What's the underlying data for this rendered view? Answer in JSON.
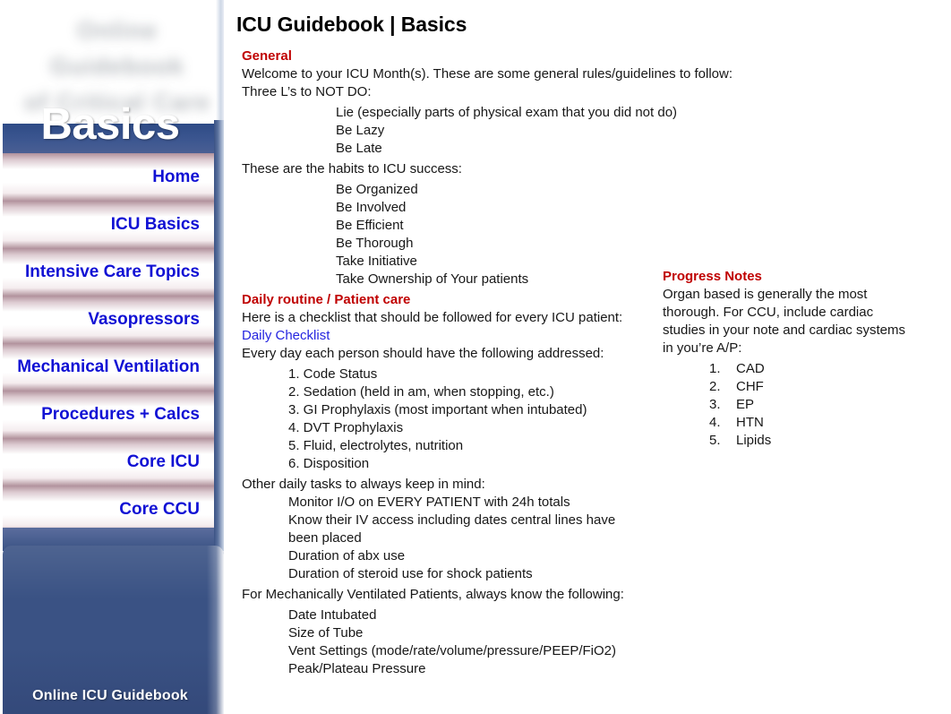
{
  "page_title": "ICU Guidebook | Basics",
  "sidebar": {
    "logo_placeholder": "Online Guidebook\nof Critical Care",
    "nav_items": [
      {
        "label": "Home"
      },
      {
        "label": "ICU Basics"
      },
      {
        "label": "Intensive Care Topics"
      },
      {
        "label": "Vasopressors"
      },
      {
        "label": "Mechanical Ventilation"
      },
      {
        "label": "Procedures + Calcs"
      },
      {
        "label": "Core ICU"
      },
      {
        "label": "Core CCU"
      }
    ],
    "brand_title": "Basics",
    "brand_subtitle": "Online ICU Guidebook"
  },
  "colors": {
    "section_heading": "#c00000",
    "nav_text": "#1111d4",
    "link": "#2424e0",
    "panel_blue": "#3a5284",
    "stripe": "#804d5e",
    "body_text": "#171717"
  },
  "content": {
    "general": {
      "heading": "General",
      "intro": "Welcome to your ICU Month(s). These are some general rules/guidelines to follow:",
      "not_do_label": "Three L’s to NOT DO:",
      "not_do_items": [
        "Lie (especially parts of physical exam that you did not do)",
        "Be Lazy",
        "Be Late"
      ],
      "habits_label": "These are the habits to ICU success:",
      "habits_items": [
        "Be Organized",
        "Be Involved",
        "Be Efficient",
        "Be Thorough",
        "Take Initiative",
        "Take Ownership of Your patients"
      ]
    },
    "daily_routine": {
      "heading": "Daily routine / Patient care",
      "intro": "Here is a checklist that should be followed for every ICU patient:",
      "link_label": "Daily Checklist",
      "addressed_label": "Every day each person should have the following addressed:",
      "checklist": [
        "1. Code Status",
        "2. Sedation (held in am, when stopping, etc.)",
        "3. GI Prophylaxis (most important when intubated)",
        "4. DVT Prophylaxis",
        "5. Fluid, electrolytes, nutrition",
        "6. Disposition"
      ],
      "other_tasks_label": "Other daily tasks to always keep in mind:",
      "other_tasks": [
        "Monitor I/O on EVERY PATIENT with 24h totals",
        "Know their IV access including dates central lines have been placed",
        "Duration of abx use",
        "Duration of steroid use for shock patients"
      ],
      "vent_label": "For Mechanically Ventilated Patients, always know the following:",
      "vent_items": [
        "Date Intubated",
        "Size of Tube",
        "Vent Settings (mode/rate/volume/pressure/PEEP/FiO2)",
        "Peak/Plateau Pressure"
      ]
    },
    "progress_notes": {
      "heading": "Progress Notes",
      "body": "Organ based is generally the most thorough. For CCU, include cardiac studies in your note and cardiac systems in you’re A/P:",
      "items": [
        {
          "num": "1.",
          "label": "CAD"
        },
        {
          "num": "2.",
          "label": "CHF"
        },
        {
          "num": "3.",
          "label": "EP"
        },
        {
          "num": "4.",
          "label": "HTN"
        },
        {
          "num": "5.",
          "label": "Lipids"
        }
      ]
    }
  }
}
